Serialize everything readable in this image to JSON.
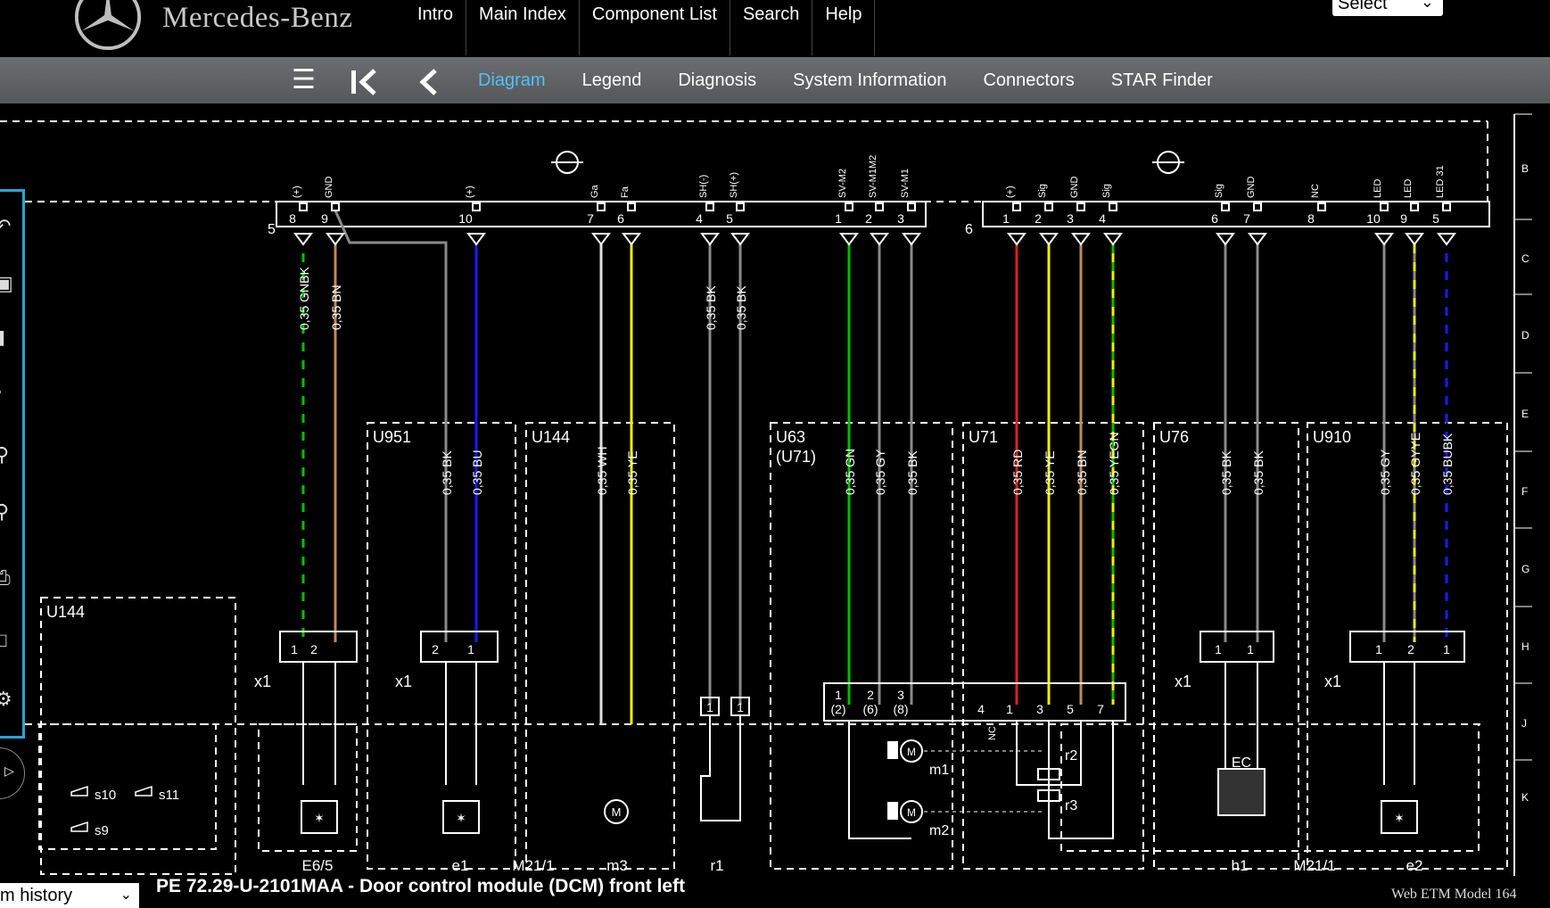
{
  "header": {
    "brand": "Mercedes-Benz",
    "nav": [
      "Intro",
      "Main Index",
      "Component List",
      "Search",
      "Help"
    ],
    "select_value": "Select"
  },
  "toolbar": {
    "tabs": [
      "Diagram",
      "Legend",
      "Diagnosis",
      "System Information",
      "Connectors",
      "STAR Finder"
    ],
    "active_tab": "Diagram"
  },
  "diagram": {
    "grid_letters": [
      "B",
      "C",
      "D",
      "E",
      "F",
      "G",
      "H",
      "J",
      "K"
    ],
    "connector_left": "5",
    "connector_right": "6",
    "pins_left": [
      {
        "sig": "(+)",
        "pin": "8",
        "wire": "0,35 GNBK",
        "color": "#00c000",
        "stripe": "#000000"
      },
      {
        "sig": "GND",
        "pin": "9",
        "wire": "0,35 BN",
        "color": "#c08a5a"
      },
      {
        "sig": "(+)",
        "pin": "10",
        "wire": "",
        "color": "#1a1aff"
      },
      {
        "sig": "Ga",
        "pin": "7",
        "wire": "",
        "color": "#e0e0e0"
      },
      {
        "sig": "Fa",
        "pin": "6",
        "wire": "",
        "color": "#f0f000"
      },
      {
        "sig": "SH(-)",
        "pin": "4",
        "wire": "0,35 BK",
        "color": "#8a8a8a"
      },
      {
        "sig": "SH(+)",
        "pin": "5",
        "wire": "0,35 BK",
        "color": "#8a8a8a"
      },
      {
        "sig": "SV-M2",
        "pin": "1",
        "wire": "",
        "color": "#00c000"
      },
      {
        "sig": "SV-M1M2",
        "pin": "2",
        "wire": "",
        "color": "#8a8a8a"
      },
      {
        "sig": "SV-M1",
        "pin": "3",
        "wire": "",
        "color": "#8a8a8a"
      }
    ],
    "pins_right": [
      {
        "sig": "(+)",
        "pin": "1",
        "color": "#e02020"
      },
      {
        "sig": "Sig",
        "pin": "2",
        "color": "#f0f000"
      },
      {
        "sig": "GND",
        "pin": "3",
        "color": "#c08a5a"
      },
      {
        "sig": "Sig",
        "pin": "4",
        "color": "#f0f000",
        "stripe": "#00c000"
      },
      {
        "sig": "Sig",
        "pin": "6",
        "color": "#8a8a8a"
      },
      {
        "sig": "GND",
        "pin": "7",
        "color": "#8a8a8a"
      },
      {
        "sig": "NC",
        "pin": "8"
      },
      {
        "sig": "LED",
        "pin": "10",
        "color": "#8a8a8a"
      },
      {
        "sig": "LED",
        "pin": "9",
        "color": "#8a8a8a",
        "stripe": "#f0f000"
      },
      {
        "sig": "LED 31",
        "pin": "5",
        "color": "#1a1aff",
        "stripe": "#000000"
      }
    ],
    "sections": [
      {
        "id": "U951",
        "wires": [
          "0,35 BK",
          "0,35 BU"
        ]
      },
      {
        "id": "U144",
        "wires": [
          "0,35 WH",
          "0,35 YE"
        ]
      },
      {
        "id": "U63",
        "sub": "(U71)",
        "wires": [
          "0,35 GN",
          "0,35 GY",
          "0,35 BK"
        ]
      },
      {
        "id": "U71",
        "wires": [
          "0,35 RD",
          "0,35 YE",
          "0,35 BN",
          "0,35 YEGN"
        ]
      },
      {
        "id": "U76",
        "wires": [
          "0,35 BK",
          "0,35 BK"
        ]
      },
      {
        "id": "U910",
        "wires": [
          "0,35 GY",
          "0,35 GYYE",
          "0,35 BUBK"
        ]
      }
    ],
    "left_box": {
      "id": "U144",
      "switches": [
        "s10",
        "s11",
        "s9"
      ]
    },
    "x1_label": "x1",
    "bottom_labels": [
      "E6/5",
      "e1",
      "M21/1",
      "m3",
      "r1",
      "h1",
      "M21/1",
      "e2"
    ],
    "component_labels": [
      "m1",
      "m2",
      "r2",
      "r3",
      "EC",
      "M",
      "NC"
    ],
    "mid_pins": [
      "1",
      "2",
      "3",
      "(2)",
      "(6)",
      "(8)",
      "4",
      "1",
      "3",
      "5",
      "7"
    ],
    "con_pins": [
      "1",
      "2",
      "2",
      "1",
      "1",
      "1",
      "1",
      "2",
      "1",
      "2",
      "3"
    ]
  },
  "bottom": {
    "history": "m history",
    "title": "PE 72.29-U-2101MAA - Door control module (DCM) front left",
    "footer": "Web ETM Model 164"
  }
}
